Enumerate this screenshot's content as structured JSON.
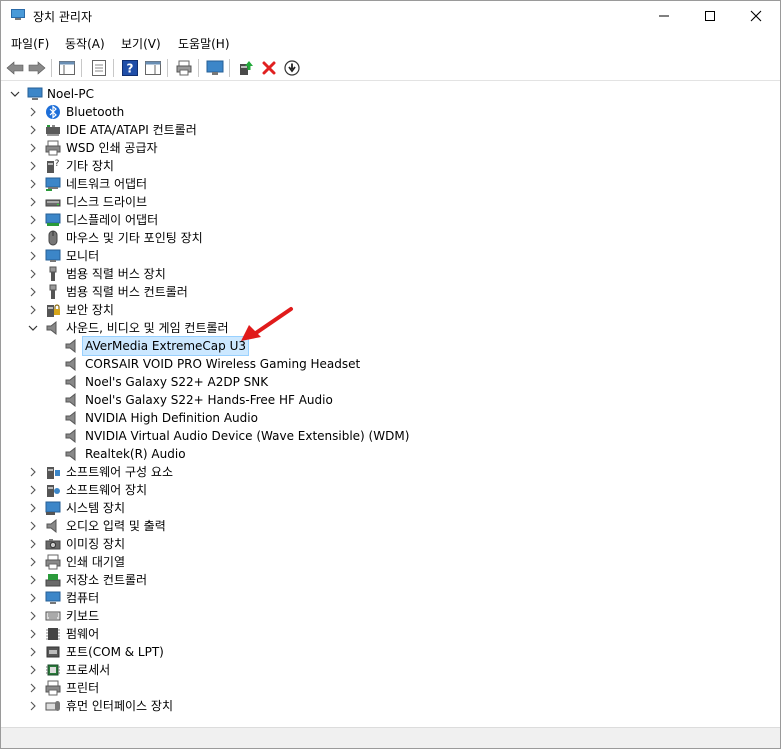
{
  "window": {
    "title": "장치 관리자"
  },
  "menu": {
    "file": "파일(F)",
    "action": "동작(A)",
    "view": "보기(V)",
    "help": "도움말(H)"
  },
  "tree": {
    "root": "Noel-PC",
    "categories": [
      {
        "label": "Bluetooth",
        "icon": "bluetooth-icon"
      },
      {
        "label": "IDE ATA/ATAPI 컨트롤러",
        "icon": "ide-controller-icon"
      },
      {
        "label": "WSD 인쇄 공급자",
        "icon": "printer-icon"
      },
      {
        "label": "기타 장치",
        "icon": "unknown-device-icon"
      },
      {
        "label": "네트워크 어댑터",
        "icon": "network-adapter-icon"
      },
      {
        "label": "디스크 드라이브",
        "icon": "disk-drive-icon"
      },
      {
        "label": "디스플레이 어댑터",
        "icon": "display-adapter-icon"
      },
      {
        "label": "마우스 및 기타 포인팅 장치",
        "icon": "mouse-icon"
      },
      {
        "label": "모니터",
        "icon": "monitor-icon"
      },
      {
        "label": "범용 직렬 버스 장치",
        "icon": "usb-icon"
      },
      {
        "label": "범용 직렬 버스 컨트롤러",
        "icon": "usb-icon"
      },
      {
        "label": "보안 장치",
        "icon": "security-device-icon"
      },
      {
        "label": "사운드, 비디오 및 게임 컨트롤러",
        "icon": "speaker-icon",
        "expanded": true
      },
      {
        "label": "소프트웨어 구성 요소",
        "icon": "software-component-icon"
      },
      {
        "label": "소프트웨어 장치",
        "icon": "software-device-icon"
      },
      {
        "label": "시스템 장치",
        "icon": "system-device-icon"
      },
      {
        "label": "오디오 입력 및 출력",
        "icon": "speaker-icon"
      },
      {
        "label": "이미징 장치",
        "icon": "camera-icon"
      },
      {
        "label": "인쇄 대기열",
        "icon": "printer-icon"
      },
      {
        "label": "저장소 컨트롤러",
        "icon": "storage-controller-icon"
      },
      {
        "label": "컴퓨터",
        "icon": "computer-icon"
      },
      {
        "label": "키보드",
        "icon": "keyboard-icon"
      },
      {
        "label": "펌웨어",
        "icon": "firmware-icon"
      },
      {
        "label": "포트(COM & LPT)",
        "icon": "port-icon"
      },
      {
        "label": "프로세서",
        "icon": "processor-icon"
      },
      {
        "label": "프린터",
        "icon": "printer-icon"
      },
      {
        "label": "휴먼 인터페이스 장치",
        "icon": "hid-icon"
      }
    ],
    "sound_children": [
      "AVerMedia ExtremeCap U3",
      "CORSAIR VOID PRO Wireless Gaming Headset",
      "Noel's Galaxy S22+ A2DP SNK",
      "Noel's Galaxy S22+ Hands-Free HF Audio",
      "NVIDIA High Definition Audio",
      "NVIDIA Virtual Audio Device (Wave Extensible) (WDM)",
      "Realtek(R) Audio"
    ],
    "selected": "AVerMedia ExtremeCap U3"
  },
  "colors": {
    "annotation_arrow": "#e01b1b",
    "selection_bg": "#cce8ff",
    "remove_red": "#e02020"
  }
}
